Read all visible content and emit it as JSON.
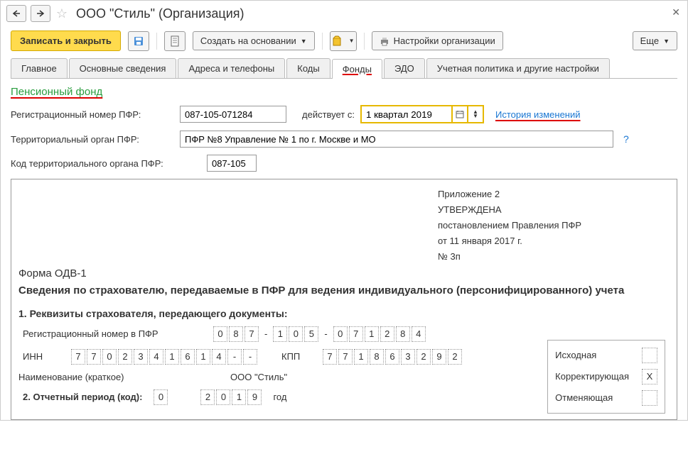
{
  "titlebar": {
    "title": "ООО \"Стиль\" (Организация)"
  },
  "toolbar": {
    "save_close": "Записать и закрыть",
    "create_based": "Создать на основании",
    "settings": "Настройки организации",
    "more": "Еще"
  },
  "tabs": {
    "main": "Главное",
    "basic": "Основные сведения",
    "addresses": "Адреса и телефоны",
    "codes": "Коды",
    "funds": "Фонды",
    "edo": "ЭДО",
    "accounting": "Учетная политика и другие настройки"
  },
  "pension": {
    "section": "Пенсионный фонд",
    "reg_label": "Регистрационный номер ПФР:",
    "reg_value": "087-105-071284",
    "effective_label": "действует с:",
    "effective_value": "1 квартал 2019",
    "history_link": "История изменений",
    "territory_label": "Территориальный орган ПФР:",
    "territory_value": "ПФР №8 Управление № 1 по г. Москве и МО",
    "code_label": "Код территориального органа ПФР:",
    "code_value": "087-105"
  },
  "doc": {
    "approval": {
      "line1": "Приложение 2",
      "line2": "УТВЕРЖДЕНА",
      "line3": "постановлением Правления ПФР",
      "line4": "от 11 января 2017 г.",
      "line5": "№ 3п"
    },
    "form_name": "Форма ОДВ-1",
    "form_desc": "Сведения по страхователю, передаваемые в ПФР для ведения индивидуального (персонифицированного) учета",
    "sec1": "1. Реквизиты страхователя, передающего документы:",
    "reg_pfr_label": "Регистрационный номер в ПФР",
    "reg_digits": [
      "0",
      "8",
      "7",
      "1",
      "0",
      "5",
      "0",
      "7",
      "1",
      "2",
      "8",
      "4"
    ],
    "inn_label": "ИНН",
    "inn_digits": [
      "7",
      "7",
      "0",
      "2",
      "3",
      "4",
      "1",
      "6",
      "1",
      "4",
      "-",
      "-"
    ],
    "kpp_label": "КПП",
    "kpp_digits": [
      "7",
      "7",
      "1",
      "8",
      "6",
      "3",
      "2",
      "9",
      "2"
    ],
    "name_label": "Наименование (краткое)",
    "name_value": "ООО \"Стиль\"",
    "sec2": "2. Отчетный период (код):",
    "period_code": [
      "0"
    ],
    "year_digits": [
      "2",
      "0",
      "1",
      "9"
    ],
    "year_label": "год",
    "types": {
      "original": "Исходная",
      "correcting": "Корректирующая",
      "cancelling": "Отменяющая",
      "mark": "X"
    }
  }
}
